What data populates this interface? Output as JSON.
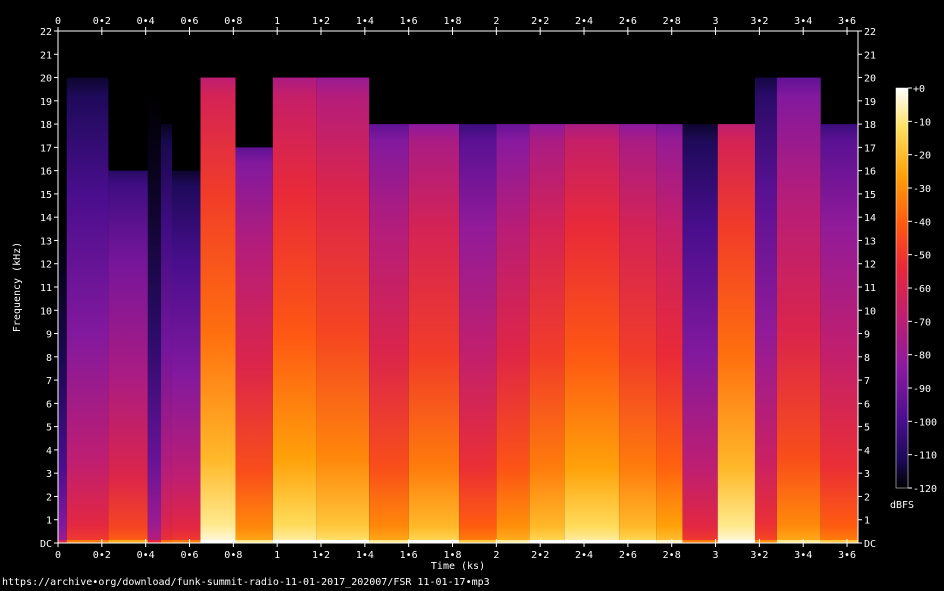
{
  "chart_data": {
    "type": "heatmap",
    "xlabel": "Time (ks)",
    "ylabel": "Frequency (kHz)",
    "x_ticks": [
      "0",
      "0•2",
      "0•4",
      "0•6",
      "0•8",
      "1",
      "1•2",
      "1•4",
      "1•6",
      "1•8",
      "2",
      "2•2",
      "2•4",
      "2•6",
      "2•8",
      "3",
      "3•2",
      "3•4",
      "3•6"
    ],
    "x_tick_values": [
      0,
      0.2,
      0.4,
      0.6,
      0.8,
      1.0,
      1.2,
      1.4,
      1.6,
      1.8,
      2.0,
      2.2,
      2.4,
      2.6,
      2.8,
      3.0,
      3.2,
      3.4,
      3.6
    ],
    "y_ticks": [
      "DC",
      "1",
      "2",
      "3",
      "4",
      "5",
      "6",
      "7",
      "8",
      "9",
      "10",
      "11",
      "12",
      "13",
      "14",
      "15",
      "16",
      "17",
      "18",
      "19",
      "20",
      "21",
      "22"
    ],
    "y_tick_values": [
      0,
      1,
      2,
      3,
      4,
      5,
      6,
      7,
      8,
      9,
      10,
      11,
      12,
      13,
      14,
      15,
      16,
      17,
      18,
      19,
      20,
      21,
      22
    ],
    "xlim": [
      0,
      3.65
    ],
    "ylim": [
      0,
      22
    ],
    "colorbar": {
      "label": "dBFS",
      "ticks": [
        "+0",
        "-10",
        "-20",
        "-30",
        "-40",
        "-50",
        "-60",
        "-70",
        "-80",
        "-90",
        "-100",
        "-110",
        "-120"
      ],
      "tick_values": [
        0,
        -10,
        -20,
        -30,
        -40,
        -50,
        -60,
        -70,
        -80,
        -90,
        -100,
        -110,
        -120
      ],
      "range": [
        -120,
        0
      ],
      "colors": [
        "#000000",
        "#1a0a55",
        "#4a0e8e",
        "#8a1aa0",
        "#c01e70",
        "#e8283a",
        "#ff5a10",
        "#ffa008",
        "#ffe060",
        "#ffffff"
      ]
    },
    "segments": [
      {
        "start": 0.0,
        "end": 0.04,
        "cutoff": 18,
        "level": 0.2
      },
      {
        "start": 0.04,
        "end": 0.23,
        "cutoff": 20,
        "level": 0.42
      },
      {
        "start": 0.23,
        "end": 0.41,
        "cutoff": 16,
        "level": 0.5
      },
      {
        "start": 0.41,
        "end": 0.47,
        "cutoff": 20,
        "level": 0.25
      },
      {
        "start": 0.47,
        "end": 0.52,
        "cutoff": 18,
        "level": 0.4
      },
      {
        "start": 0.52,
        "end": 0.65,
        "cutoff": 16,
        "level": 0.42
      },
      {
        "start": 0.65,
        "end": 0.81,
        "cutoff": 20,
        "level": 0.8
      },
      {
        "start": 0.81,
        "end": 0.98,
        "cutoff": 17,
        "level": 0.62
      },
      {
        "start": 0.98,
        "end": 1.18,
        "cutoff": 20,
        "level": 0.76
      },
      {
        "start": 1.18,
        "end": 1.42,
        "cutoff": 20,
        "level": 0.72
      },
      {
        "start": 1.42,
        "end": 1.6,
        "cutoff": 18,
        "level": 0.62
      },
      {
        "start": 1.6,
        "end": 1.83,
        "cutoff": 18,
        "level": 0.7
      },
      {
        "start": 1.83,
        "end": 2.0,
        "cutoff": 18,
        "level": 0.55
      },
      {
        "start": 2.0,
        "end": 2.15,
        "cutoff": 18,
        "level": 0.63
      },
      {
        "start": 2.15,
        "end": 2.31,
        "cutoff": 18,
        "level": 0.7
      },
      {
        "start": 2.31,
        "end": 2.56,
        "cutoff": 18,
        "level": 0.76
      },
      {
        "start": 2.56,
        "end": 2.73,
        "cutoff": 18,
        "level": 0.7
      },
      {
        "start": 2.73,
        "end": 2.85,
        "cutoff": 18,
        "level": 0.66
      },
      {
        "start": 2.85,
        "end": 3.01,
        "cutoff": 18,
        "level": 0.42
      },
      {
        "start": 3.01,
        "end": 3.18,
        "cutoff": 18,
        "level": 0.8
      },
      {
        "start": 3.18,
        "end": 3.28,
        "cutoff": 20,
        "level": 0.45
      },
      {
        "start": 3.28,
        "end": 3.48,
        "cutoff": 20,
        "level": 0.62
      },
      {
        "start": 3.48,
        "end": 3.65,
        "cutoff": 18,
        "level": 0.55
      }
    ]
  },
  "footer": {
    "source_url": "https://archive•org/download/funk-summit-radio-11-01-2017_202007/FSR 11-01-17•mp3"
  }
}
